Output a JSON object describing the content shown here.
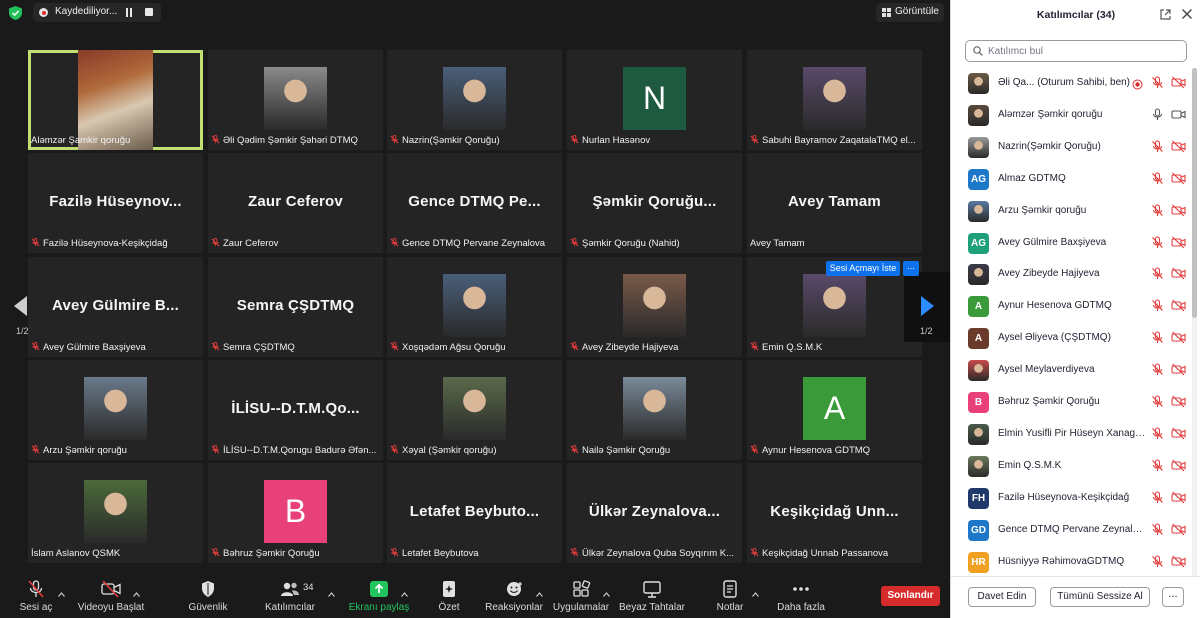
{
  "topbar": {
    "recording_label": "Kaydediliyor...",
    "view_label": "Görüntüle"
  },
  "grid": {
    "tiles": [
      {
        "name": "Aləmzər Şamkir qoruğu",
        "kind": "video",
        "active": true,
        "muted": false
      },
      {
        "name": "Əli Qədim Şəmkir Şəhəri DTMQ",
        "kind": "photo",
        "muted": true
      },
      {
        "name": "Nazrin(Şəmkir Qoruğu)",
        "kind": "photo",
        "muted": true
      },
      {
        "name": "Nurlan Hasənov",
        "kind": "letter",
        "letter": "N",
        "color": "#1e5a40",
        "muted": true
      },
      {
        "name": "Sabuhi Bayramov ZaqatalaTMQ el...",
        "kind": "photo",
        "muted": true
      },
      {
        "name": "Fazilə Hüseynova-Keşikçidağ",
        "kind": "text",
        "big": "Fazilə Hüseynov...",
        "muted": true
      },
      {
        "name": "Zaur Ceferov",
        "kind": "text",
        "big": "Zaur Ceferov",
        "muted": true
      },
      {
        "name": "Gence DTMQ Pervane Zeynalova",
        "kind": "text",
        "big": "Gence DTMQ Pe...",
        "muted": true
      },
      {
        "name": "Şəmkir Qoruğu (Nahid)",
        "kind": "text",
        "big": "Şəmkir Qoruğu...",
        "muted": true
      },
      {
        "name": "Avey Tamam",
        "kind": "text",
        "big": "Avey Tamam",
        "muted": false
      },
      {
        "name": "Avey Gülmire Baxşiyeva",
        "kind": "text",
        "big": "Avey Gülmire B...",
        "muted": true
      },
      {
        "name": "Semra ÇŞDTMQ",
        "kind": "text",
        "big": "Semra ÇŞDTMQ",
        "muted": true
      },
      {
        "name": "Xoşqədəm Ağsu Qoruğu",
        "kind": "photo",
        "muted": true
      },
      {
        "name": "Avey Zibeyde Hajiyeva",
        "kind": "photo",
        "muted": true
      },
      {
        "name": "Emin Q.S.M.K",
        "kind": "photo",
        "muted": true
      },
      {
        "name": "Arzu Şəmkir qoruğu",
        "kind": "photo",
        "muted": true
      },
      {
        "name": "İLİSU--D.T.M.Qorugu Badurə Əfən...",
        "kind": "text",
        "big": "İLİSU--D.T.M.Qo...",
        "muted": true
      },
      {
        "name": "Xəyal (Şəmkir qoruğu)",
        "kind": "photo",
        "muted": true
      },
      {
        "name": "Nailə Şəmkir Qoruğu",
        "kind": "photo",
        "muted": true
      },
      {
        "name": "Aynur Hesenova GDTMQ",
        "kind": "letter",
        "letter": "A",
        "color": "#3a9a3a",
        "muted": true
      },
      {
        "name": "İslam Aslanov QSMK",
        "kind": "photo",
        "muted": false
      },
      {
        "name": "Bəhruz Şəmkir Qoruğu",
        "kind": "letter",
        "letter": "B",
        "color": "#e8417a",
        "muted": true
      },
      {
        "name": "Letafet Beybutova",
        "kind": "text",
        "big": "Letafet Beybuto...",
        "muted": true
      },
      {
        "name": "Ülkər Zeynalova Quba Soyqırım K...",
        "kind": "text",
        "big": "Ülkər Zeynalova...",
        "muted": true
      },
      {
        "name": "Keşikçidağ Unnab Passanova",
        "kind": "text",
        "big": "Keşikçidağ Unn...",
        "muted": true
      }
    ],
    "page_left": "1/2",
    "page_right": "1/2",
    "ask_unmute_label": "Sesi Açmayı İste",
    "more_label": "..."
  },
  "toolbar": {
    "items": [
      {
        "id": "mute",
        "label": "Sesi aç",
        "icon": "mic-muted-icon"
      },
      {
        "id": "video",
        "label": "Videoyu Başlat",
        "icon": "video-off-icon"
      },
      {
        "id": "security",
        "label": "Güvenlik",
        "icon": "shield-icon"
      },
      {
        "id": "participants",
        "label": "Katılımcılar",
        "icon": "participants-icon",
        "count": "34"
      },
      {
        "id": "share",
        "label": "Ekranı paylaş",
        "icon": "share-screen-icon"
      },
      {
        "id": "summary",
        "label": "Özet",
        "icon": "summary-icon"
      },
      {
        "id": "reactions",
        "label": "Reaksiyonlar",
        "icon": "emoji-icon"
      },
      {
        "id": "apps",
        "label": "Uygulamalar",
        "icon": "apps-icon"
      },
      {
        "id": "whiteboard",
        "label": "Beyaz Tahtalar",
        "icon": "whiteboard-icon"
      },
      {
        "id": "notes",
        "label": "Notlar",
        "icon": "notes-icon"
      },
      {
        "id": "more",
        "label": "Daha fazla",
        "icon": "more-icon"
      }
    ],
    "end_label": "Sonlandır"
  },
  "panel": {
    "title": "Katılımcılar (34)",
    "search_placeholder": "Katılımcı bul",
    "participants": [
      {
        "name": "Əli Qa...  (Oturum Sahibi, ben)",
        "avatar": "photo",
        "color": "#6b5a44",
        "mic": "muted",
        "video": "off",
        "rec": true
      },
      {
        "name": "Aləmzər Şəmkir qoruğu",
        "avatar": "photo",
        "color": "#5a4a3c",
        "mic": "on",
        "video": "on"
      },
      {
        "name": "Nazrin(Şəmkir Qoruğu)",
        "avatar": "photo",
        "color": "#9a9a9a",
        "mic": "muted",
        "video": "off"
      },
      {
        "name": "Almaz GDTMQ",
        "avatar": "initials",
        "initials": "AG",
        "color": "#1e78c8",
        "mic": "muted",
        "video": "off"
      },
      {
        "name": "Arzu Şəmkir qoruğu",
        "avatar": "photo",
        "color": "#5a7aa0",
        "mic": "muted",
        "video": "off"
      },
      {
        "name": "Avey Gülmire Baxşiyeva",
        "avatar": "initials",
        "initials": "AG",
        "color": "#1ea07a",
        "mic": "muted",
        "video": "off"
      },
      {
        "name": "Avey Zibeyde Hajiyeva",
        "avatar": "photo",
        "color": "#3a3a4a",
        "mic": "muted",
        "video": "off"
      },
      {
        "name": "Aynur Hesenova GDTMQ",
        "avatar": "initials",
        "initials": "A",
        "color": "#3a9a3a",
        "mic": "muted",
        "video": "off"
      },
      {
        "name": "Aysel Əliyeva (ÇŞDTMQ)",
        "avatar": "initials",
        "initials": "A",
        "color": "#6a3a2a",
        "mic": "muted",
        "video": "off"
      },
      {
        "name": "Aysel Meylaverdiyeva",
        "avatar": "photo",
        "color": "#c84a4a",
        "mic": "muted",
        "video": "off"
      },
      {
        "name": "Bəhruz Şəmkir Qoruğu",
        "avatar": "initials",
        "initials": "B",
        "color": "#e8417a",
        "mic": "muted",
        "video": "off"
      },
      {
        "name": "Elmin Yusifli Pir Hüseyn Xanaga...",
        "avatar": "photo",
        "color": "#4a5a4a",
        "mic": "muted",
        "video": "off"
      },
      {
        "name": "Emin Q.S.M.K",
        "avatar": "photo",
        "color": "#6a7a5a",
        "mic": "muted",
        "video": "off"
      },
      {
        "name": "Fazilə Hüseynova-Keşikçidağ",
        "avatar": "initials",
        "initials": "FH",
        "color": "#1f3a6a",
        "mic": "muted",
        "video": "off"
      },
      {
        "name": "Gence DTMQ Pervane Zeynalova",
        "avatar": "initials",
        "initials": "GD",
        "color": "#1e78c8",
        "mic": "muted",
        "video": "off"
      },
      {
        "name": "Hüsniyyə RəhimovaGDTMQ",
        "avatar": "initials",
        "initials": "HR",
        "color": "#f0a020",
        "mic": "muted",
        "video": "off"
      }
    ],
    "invite_label": "Davet Edin",
    "mute_all_label": "Tümünü Sessize Al",
    "more_label": "..."
  }
}
